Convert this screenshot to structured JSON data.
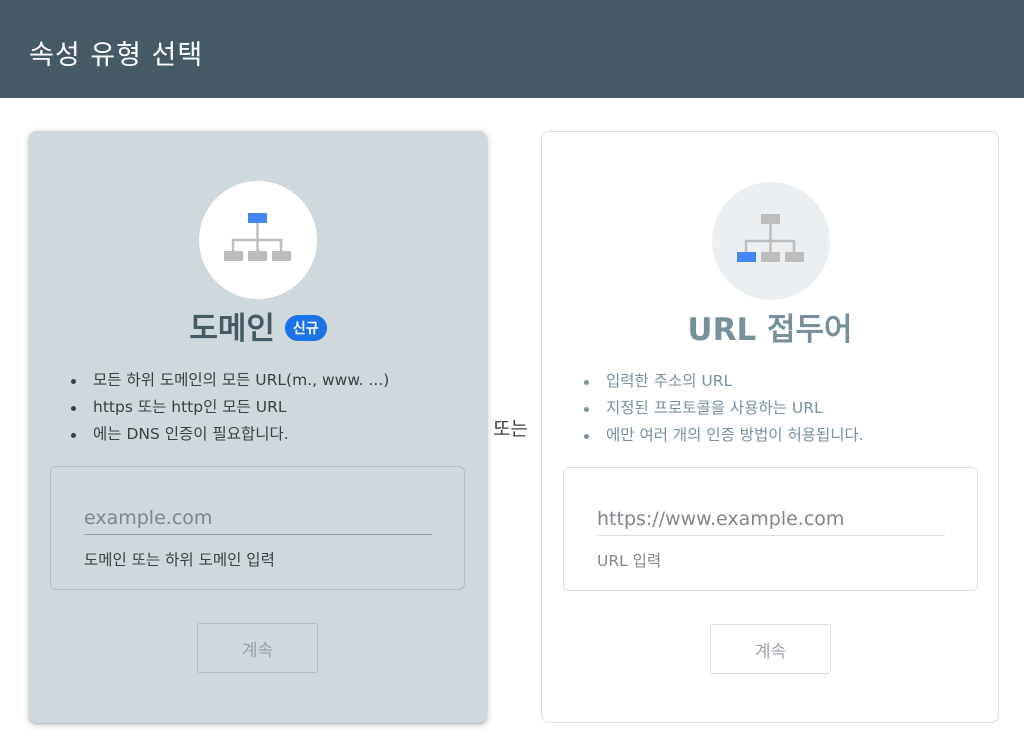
{
  "header": {
    "title": "속성 유형 선택"
  },
  "domain_card": {
    "title": "도메인",
    "badge": "신규",
    "icon": "sitemap-icon-top-highlighted",
    "bullets": [
      "모든 하위 도메인의 모든 URL(m., www. ...)",
      "https 또는 http인 모든 URL",
      "에는 DNS 인증이 필요합니다."
    ],
    "input_placeholder": "example.com",
    "input_hint": "도메인 또는 하위 도메인 입력",
    "continue_label": "계속"
  },
  "separator": {
    "label": "또는"
  },
  "url_card": {
    "title": "URL 접두어",
    "icon": "sitemap-icon-bottom-left-highlighted",
    "bullets": [
      "입력한 주소의 URL",
      "지정된 프로토콜을 사용하는 URL",
      "에만 여러 개의 인증 방법이 허용됩니다."
    ],
    "input_placeholder": "https://www.example.com",
    "input_hint": "URL 입력",
    "continue_label": "계속"
  },
  "colors": {
    "header_bg": "#455a64",
    "domain_card_bg": "#cfd8dc",
    "accent_blue": "#4285f4",
    "badge_blue": "#1a73e8",
    "icon_gray": "#bdbdbd"
  }
}
